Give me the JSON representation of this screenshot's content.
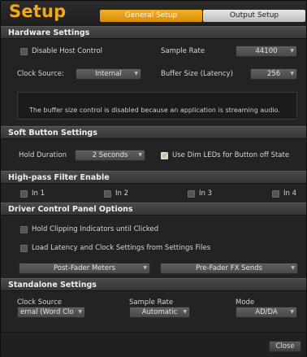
{
  "window": {
    "title": "Setup"
  },
  "tabs": [
    {
      "label": "General Setup",
      "active": true
    },
    {
      "label": "Output Setup",
      "active": false
    }
  ],
  "hardware": {
    "heading": "Hardware Settings",
    "disable_host_control": {
      "label": "Disable Host Control",
      "checked": false
    },
    "sample_rate": {
      "label": "Sample Rate",
      "value": "44100"
    },
    "clock_source": {
      "label": "Clock Source:",
      "value": "Internal"
    },
    "buffer_size": {
      "label": "Buffer Size (Latency)",
      "value": "256"
    },
    "info": "The buffer size control is disabled because an application is streaming audio."
  },
  "soft_button": {
    "heading": "Soft Button Settings",
    "hold_duration": {
      "label": "Hold Duration",
      "value": "2 Seconds"
    },
    "dim_leds": {
      "label": "Use Dim LEDs for Button off State",
      "checked": true
    }
  },
  "highpass": {
    "heading": "High-pass Filter Enable",
    "inputs": [
      {
        "label": "In 1",
        "checked": false
      },
      {
        "label": "In 2",
        "checked": false
      },
      {
        "label": "In 3",
        "checked": false
      },
      {
        "label": "In 4",
        "checked": false
      }
    ]
  },
  "driver": {
    "heading": "Driver Control Panel Options",
    "hold_clipping": {
      "label": "Hold Clipping Indicators until Clicked",
      "checked": false
    },
    "load_latency": {
      "label": "Load Latency and Clock Settings from Settings Files",
      "checked": false
    },
    "meter_mode": "Post-Fader Meters",
    "fx_mode": "Pre-Fader FX Sends"
  },
  "standalone": {
    "heading": "Standalone Settings",
    "clock_source": {
      "label": "Clock Source",
      "value": "ernal (Word Clo"
    },
    "sample_rate": {
      "label": "Sample Rate",
      "value": "Automatic"
    },
    "mode": {
      "label": "Mode",
      "value": "AD/DA"
    }
  },
  "footer": {
    "close_label": "Close"
  },
  "colors": {
    "accent": "#f2a818",
    "background": "#232323",
    "section": "#3f3f3f"
  }
}
